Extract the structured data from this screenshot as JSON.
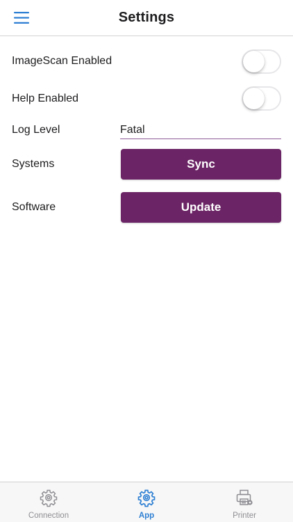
{
  "header": {
    "title": "Settings"
  },
  "settings": {
    "imagescan": {
      "label": "ImageScan Enabled",
      "enabled": false
    },
    "help": {
      "label": "Help Enabled",
      "enabled": false
    },
    "log_level": {
      "label": "Log Level",
      "value": "Fatal"
    },
    "systems": {
      "label": "Systems",
      "button_label": "Sync"
    },
    "software": {
      "label": "Software",
      "button_label": "Update"
    }
  },
  "tabbar": {
    "tabs": [
      {
        "label": "Connection",
        "icon": "gear-icon",
        "active": false
      },
      {
        "label": "App",
        "icon": "gear-icon",
        "active": true
      },
      {
        "label": "Printer",
        "icon": "printer-icon",
        "active": false
      }
    ]
  },
  "colors": {
    "accent": "#2d7fd3",
    "button": "#6b2465",
    "field_underline": "#8e5a98",
    "inactive_tab": "#8e8e93"
  }
}
